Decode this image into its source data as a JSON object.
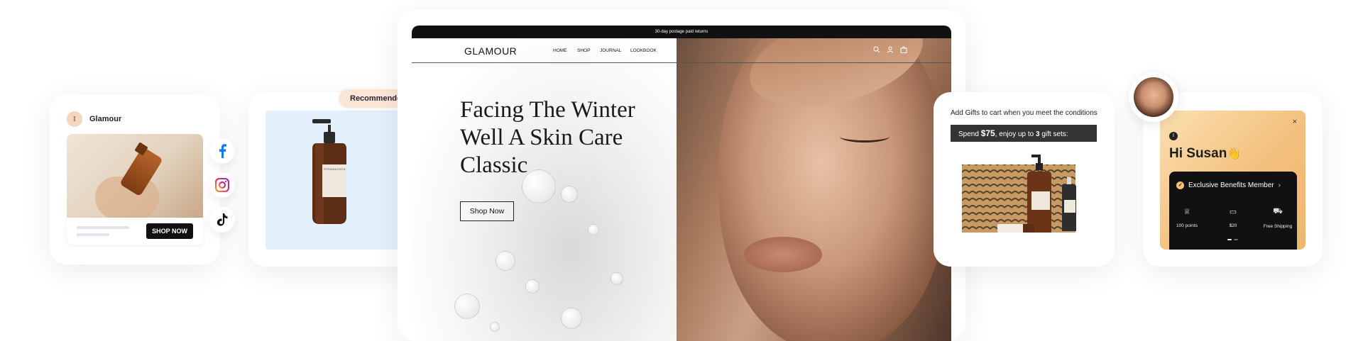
{
  "social_card": {
    "brand_initial": "I",
    "brand_name": "Glamour",
    "shop_button": "SHOP NOW",
    "icons": [
      "facebook-icon",
      "instagram-icon",
      "tiktok-icon"
    ]
  },
  "recommended": {
    "pill_label": "Recommended For You",
    "product_label": "SPRAMASSEN"
  },
  "store": {
    "announcement": "30-day postage paid returns",
    "logo": "GLAMOUR",
    "nav": [
      "HOME",
      "SHOP",
      "JOURNAL",
      "LOOKBOOK"
    ],
    "hero_title_lines": [
      "Facing The Winter",
      "Well A Skin Care",
      "Classic"
    ],
    "hero_button": "Shop Now",
    "header_icons": [
      "search-icon",
      "user-icon",
      "bag-icon"
    ]
  },
  "gifts": {
    "title": "Add Gifts to cart when you meet the conditions",
    "bar_prefix": "Spend ",
    "bar_amount": "$75",
    "bar_middle": ", enjoy up to ",
    "bar_count": "3",
    "bar_suffix": " gift sets:"
  },
  "member": {
    "close": "×",
    "brand_initial": "I",
    "greeting": "Hi Susan",
    "greeting_emoji": "👋",
    "badge": "Exclusive Benefits Member",
    "perks": [
      {
        "icon": "trophy-icon",
        "label": "100 points"
      },
      {
        "icon": "ticket-icon",
        "label": "$20"
      },
      {
        "icon": "truck-icon",
        "label": "Free Shipping"
      }
    ]
  }
}
